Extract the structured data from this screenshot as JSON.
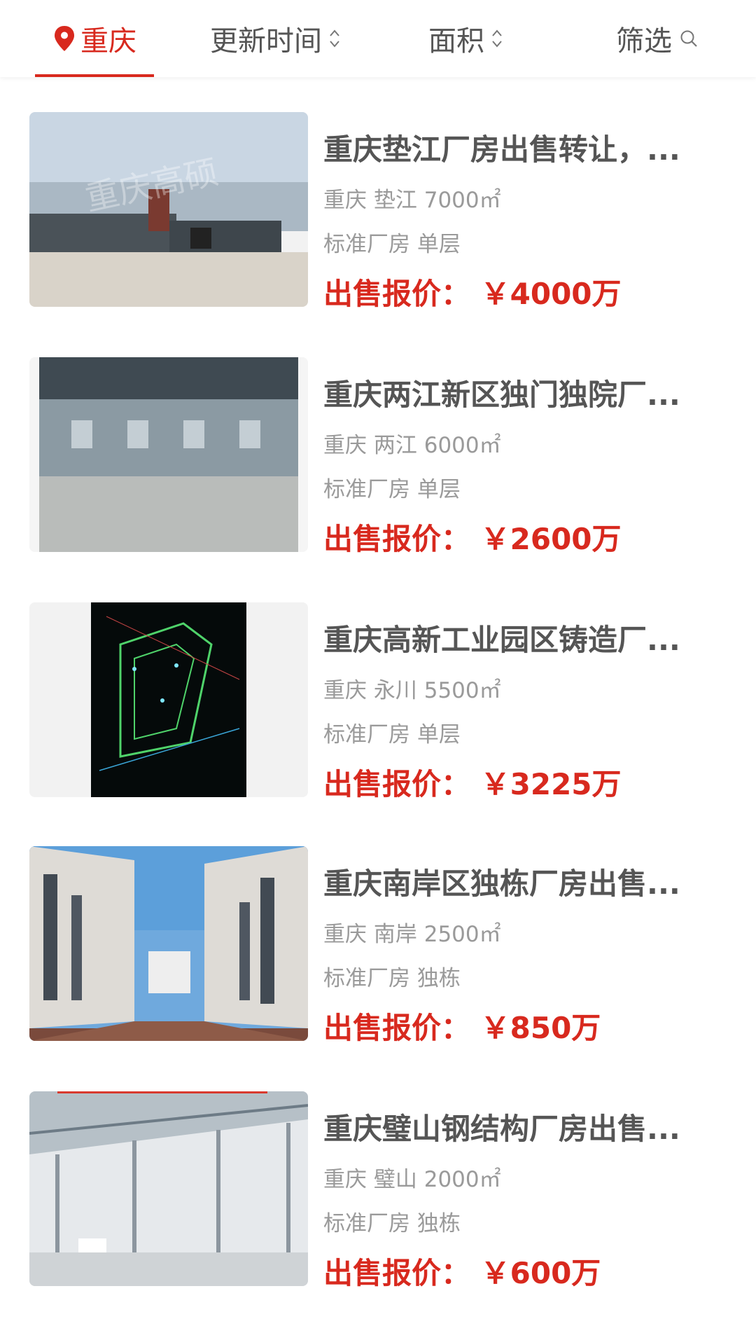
{
  "filters": {
    "city": "重庆",
    "update_time": "更新时间",
    "area": "面积",
    "filter": "筛选"
  },
  "listings": [
    {
      "title": "重庆垫江厂房出售转让，...",
      "city": "重庆",
      "district": "垫江",
      "area": "7000㎡",
      "type": "标准厂房",
      "floors": "单层",
      "price_label": "出售报价：",
      "price": "￥4000万",
      "watermark": "重庆高硕"
    },
    {
      "title": "重庆两江新区独门独院厂...",
      "city": "重庆",
      "district": "两江",
      "area": "6000㎡",
      "type": "标准厂房",
      "floors": "单层",
      "price_label": "出售报价：",
      "price": "￥2600万"
    },
    {
      "title": "重庆高新工业园区铸造厂...",
      "city": "重庆",
      "district": "永川",
      "area": "5500㎡",
      "type": "标准厂房",
      "floors": "单层",
      "price_label": "出售报价：",
      "price": "￥3225万"
    },
    {
      "title": "重庆南岸区独栋厂房出售...",
      "city": "重庆",
      "district": "南岸",
      "area": "2500㎡",
      "type": "标准厂房",
      "floors": "独栋",
      "price_label": "出售报价：",
      "price": "￥850万"
    },
    {
      "title": "重庆璧山钢结构厂房出售...",
      "city": "重庆",
      "district": "璧山",
      "area": "2000㎡",
      "type": "标准厂房",
      "floors": "独栋",
      "price_label": "出售报价：",
      "price": "￥600万"
    }
  ],
  "icons": {
    "city": "location-pin-icon",
    "sort": "sort-arrows-icon",
    "filter": "search-icon"
  },
  "colors": {
    "accent": "#d8291e",
    "title": "#555555",
    "meta": "#9a9a9a"
  }
}
